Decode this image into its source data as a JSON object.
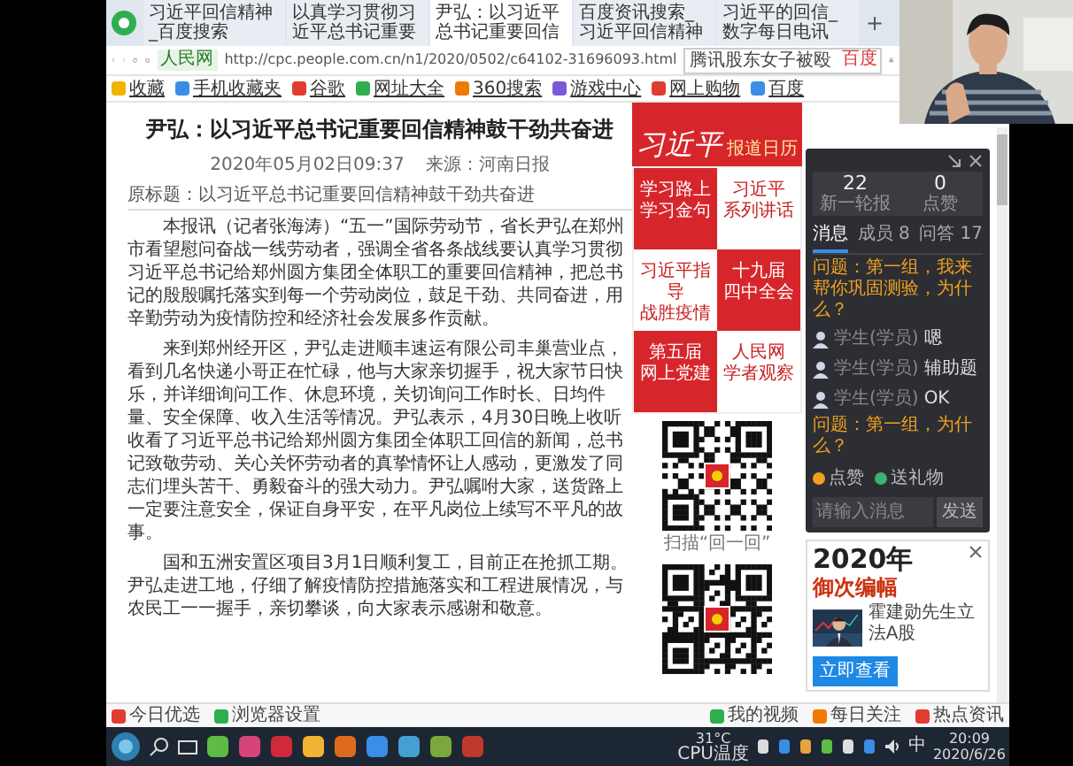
{
  "browser": {
    "tabs": [
      {
        "label": "习近平回信精神_百度搜索",
        "selected": false
      },
      {
        "label": "以真学习贯彻习近平总书记重要",
        "selected": false
      },
      {
        "label": "尹弘：以习近平总书记重要回信",
        "selected": true
      },
      {
        "label": "百度资讯搜索_习近平回信精神",
        "selected": false
      },
      {
        "label": "习近平的回信_数字每日电讯",
        "selected": false
      }
    ],
    "new_tab": "+",
    "site_badge": "人民网",
    "url": "http://cpc.people.com.cn/n1/2020/0502/c64102-31696093.html",
    "search": {
      "value": "腾讯股东女子被殴",
      "engine": "百度"
    },
    "bookmarks": [
      "收藏",
      "手机收藏夹",
      "谷歌",
      "网址大全",
      "360搜索",
      "游戏中心",
      "网上购物",
      "百度"
    ]
  },
  "article": {
    "title": "尹弘：以习近平总书记重要回信精神鼓干劲共奋进",
    "meta": [
      "2020年05月02日09:37",
      "来源：河南日报"
    ],
    "subtitle": "原标题：以习近平总书记重要回信精神鼓干劲共奋进",
    "paragraphs": [
      "本报讯（记者张海涛）“五一”国际劳动节，省长尹弘在郑州市看望慰问奋战一线劳动者，强调全省各条战线要认真学习贯彻习近平总书记给郑州圆方集团全体职工的重要回信精神，把总书记的殷殷嘱托落实到每一个劳动岗位，鼓足干劲、共同奋进，用辛勤劳动为疫情防控和经济社会发展多作贡献。",
      "来到郑州经开区，尹弘走进顺丰速运有限公司丰巢营业点，看到几名快递小哥正在忙碌，他与大家亲切握手，祝大家节日快乐，并详细询问工作、休息环境，关切询问工作时长、日均件量、安全保障、收入生活等情况。尹弘表示，4月30日晚上收听收看了习近平总书记给郑州圆方集团全体职工回信的新闻，总书记致敬劳动、关心关怀劳动者的真挚情怀让人感动，更激发了同志们埋头苦干、勇毅奋斗的强大动力。尹弘嘱咐大家，送货路上一定要注意安全，保证自身平安，在平凡岗位上续写不平凡的故事。",
      "国和五洲安置区项目3月1日顺利复工，目前正在抢抓工期。尹弘走进工地，仔细了解疫情防控措施落实和工程进展情况，与农民工一一握手，亲切攀谈，向大家表示感谢和敬意。"
    ]
  },
  "sidebar": {
    "logo": "习近平",
    "logo_sub": "报道日历",
    "tiles": [
      {
        "lines": [
          "学习路上",
          "学习金句"
        ],
        "color": "#d7262b"
      },
      {
        "lines": [
          "习近平",
          "系列讲话"
        ],
        "color": "#ffffff"
      },
      {
        "lines": [
          "习近平指导",
          "战胜疫情"
        ],
        "color": "#ffffff"
      },
      {
        "lines": [
          "十九届",
          "四中全会"
        ],
        "color": "#d7262b"
      },
      {
        "lines": [
          "第五届",
          "网上党建"
        ],
        "color": "#d7262b"
      },
      {
        "lines": [
          "人民网",
          "学者观察"
        ],
        "color": "#ffffff"
      }
    ],
    "qr_caption": "扫描“回一回”"
  },
  "chat": {
    "stats": [
      {
        "value": "22",
        "label": "新一轮报"
      },
      {
        "value": "0",
        "label": "点赞"
      }
    ],
    "tabs": [
      {
        "label": "消息",
        "selected": true
      },
      {
        "label": "成员 8",
        "selected": false
      },
      {
        "label": "问答 17",
        "selected": false
      }
    ],
    "messages": [
      {
        "kind": "question",
        "text": "问题：第一组，我来帮你巩固测验，为什么？"
      },
      {
        "kind": "user",
        "name": "学生(学员)",
        "text": "嗯"
      },
      {
        "kind": "user",
        "name": "学生(学员)",
        "text": "辅助题"
      },
      {
        "kind": "user",
        "name": "学生(学员)",
        "text": "OK"
      },
      {
        "kind": "question",
        "text": "问题：第一组，为什么？"
      }
    ],
    "actions": [
      {
        "label": "点赞",
        "color": "#f0a020"
      },
      {
        "label": "送礼物",
        "color": "#3cb371"
      }
    ],
    "input_placeholder": "请输入消息",
    "send": "发送"
  },
  "ad": {
    "headline": "2020年",
    "subline": "御次编幅",
    "caption": "霍建勋先生立法A股",
    "button": "立即查看"
  },
  "status_bar": {
    "left": [
      "今日优选",
      "浏览器设置"
    ],
    "right": [
      "我的视频",
      "每日关注",
      "热点资讯"
    ]
  },
  "taskbar": {
    "temperature": "31°C",
    "temp_label": "CPU温度",
    "ime": "中",
    "time": "20:09",
    "date": "2020/6/26"
  }
}
